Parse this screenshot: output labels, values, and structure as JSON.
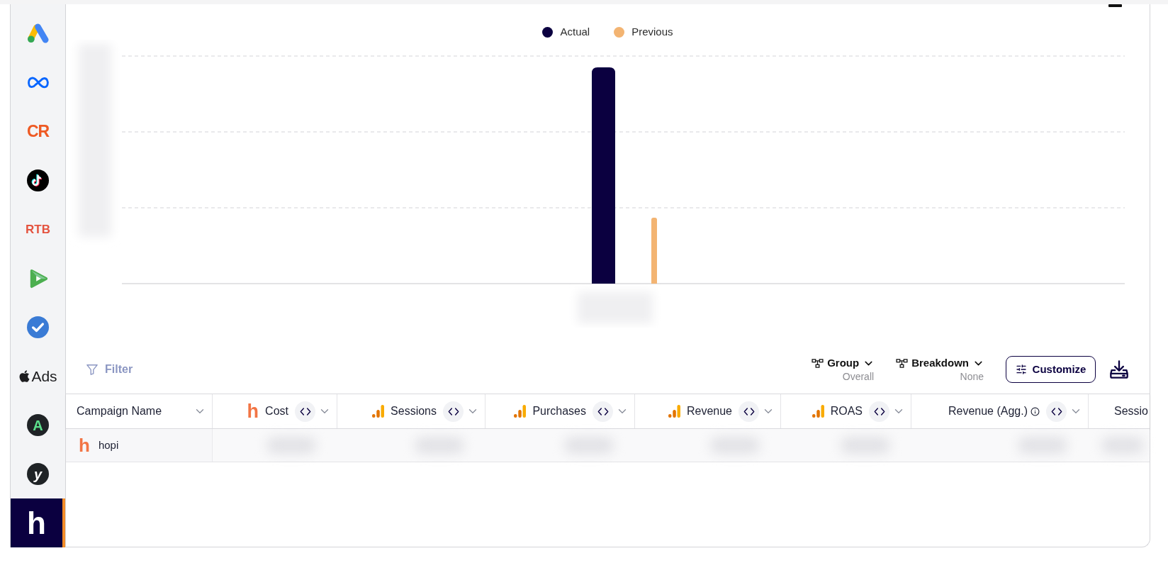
{
  "sidebar": {
    "items": [
      {
        "kind": "triangle-logo",
        "selected": false
      },
      {
        "kind": "infinity-logo",
        "selected": false
      },
      {
        "kind": "monogram",
        "label": "CR",
        "color": "#ee5a24",
        "selected": false
      },
      {
        "kind": "note-logo",
        "selected": false
      },
      {
        "kind": "wordmark",
        "label": "RTB",
        "color": "#e4533f",
        "selected": false
      },
      {
        "kind": "play-logo",
        "selected": false
      },
      {
        "kind": "check-logo",
        "selected": false
      },
      {
        "kind": "apple-wordmark",
        "label": "Ads",
        "selected": false
      },
      {
        "kind": "letter-circle",
        "label": "A",
        "color": "#5ce08c",
        "italic": false,
        "selected": false
      },
      {
        "kind": "letter-circle",
        "label": "y",
        "color": "#ffffff",
        "italic": true,
        "selected": false
      },
      {
        "kind": "letter",
        "label": "h",
        "selected": true
      }
    ]
  },
  "chart": {
    "series": [
      {
        "name": "Actual",
        "color": "#0b0040"
      },
      {
        "name": "Previous",
        "color": "#f3b472"
      }
    ]
  },
  "toolbar": {
    "filter": "Filter",
    "group": {
      "label": "Group",
      "value": "Overall"
    },
    "breakdown": {
      "label": "Breakdown",
      "value": "None"
    },
    "customize": "Customize"
  },
  "table": {
    "columns": [
      {
        "label": "Campaign Name",
        "kind": "dimension"
      },
      {
        "label": "Cost",
        "kind": "metric",
        "source": {
          "kind": "letter",
          "text": "h"
        },
        "info": false
      },
      {
        "label": "Sessions",
        "kind": "metric",
        "source": {
          "kind": "bars"
        },
        "info": false
      },
      {
        "label": "Purchases",
        "kind": "metric",
        "source": {
          "kind": "bars"
        },
        "info": false
      },
      {
        "label": "Revenue",
        "kind": "metric",
        "source": {
          "kind": "bars"
        },
        "info": false
      },
      {
        "label": "ROAS",
        "kind": "metric",
        "source": {
          "kind": "bars"
        },
        "info": false
      },
      {
        "label": "Revenue (Agg.)",
        "kind": "metric",
        "info": true
      },
      {
        "label": "Sessio",
        "kind": "partial"
      }
    ],
    "rows": [
      {
        "logo": "h",
        "campaign_name": "hopi"
      }
    ]
  }
}
